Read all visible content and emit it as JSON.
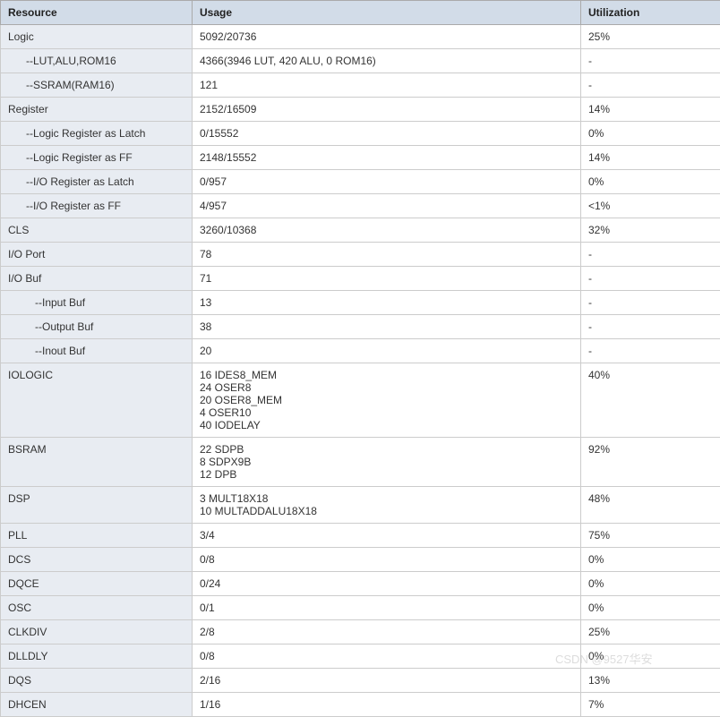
{
  "headers": {
    "resource": "Resource",
    "usage": "Usage",
    "utilization": "Utilization"
  },
  "rows": [
    {
      "resource": "Logic",
      "usage": "5092/20736",
      "utilization": "25%",
      "indent": 0
    },
    {
      "resource": "--LUT,ALU,ROM16",
      "usage": "4366(3946 LUT, 420 ALU, 0 ROM16)",
      "utilization": "-",
      "indent": 1
    },
    {
      "resource": "--SSRAM(RAM16)",
      "usage": "121",
      "utilization": "-",
      "indent": 1
    },
    {
      "resource": "Register",
      "usage": "2152/16509",
      "utilization": "14%",
      "indent": 0
    },
    {
      "resource": "--Logic Register as Latch",
      "usage": "0/15552",
      "utilization": "0%",
      "indent": 1
    },
    {
      "resource": "--Logic Register as FF",
      "usage": "2148/15552",
      "utilization": "14%",
      "indent": 1
    },
    {
      "resource": "--I/O Register as Latch",
      "usage": "0/957",
      "utilization": "0%",
      "indent": 1
    },
    {
      "resource": "--I/O Register as FF",
      "usage": "4/957",
      "utilization": "<1%",
      "indent": 1
    },
    {
      "resource": "CLS",
      "usage": "3260/10368",
      "utilization": "32%",
      "indent": 0
    },
    {
      "resource": "I/O Port",
      "usage": "78",
      "utilization": "-",
      "indent": 0
    },
    {
      "resource": "I/O Buf",
      "usage": "71",
      "utilization": "-",
      "indent": 0
    },
    {
      "resource": "--Input Buf",
      "usage": "13",
      "utilization": "-",
      "indent": 2
    },
    {
      "resource": "--Output Buf",
      "usage": "38",
      "utilization": "-",
      "indent": 2
    },
    {
      "resource": "--Inout Buf",
      "usage": "20",
      "utilization": "-",
      "indent": 2
    },
    {
      "resource": "IOLOGIC",
      "usage": "16 IDES8_MEM\n24 OSER8\n20 OSER8_MEM\n4 OSER10\n40 IODELAY",
      "utilization": "40%",
      "indent": 0
    },
    {
      "resource": "BSRAM",
      "usage": "22 SDPB\n8 SDPX9B\n12 DPB",
      "utilization": "92%",
      "indent": 0
    },
    {
      "resource": "DSP",
      "usage": "3 MULT18X18\n10 MULTADDALU18X18",
      "utilization": "48%",
      "indent": 0
    },
    {
      "resource": "PLL",
      "usage": "3/4",
      "utilization": "75%",
      "indent": 0
    },
    {
      "resource": "DCS",
      "usage": "0/8",
      "utilization": "0%",
      "indent": 0
    },
    {
      "resource": "DQCE",
      "usage": "0/24",
      "utilization": "0%",
      "indent": 0
    },
    {
      "resource": "OSC",
      "usage": "0/1",
      "utilization": "0%",
      "indent": 0
    },
    {
      "resource": "CLKDIV",
      "usage": "2/8",
      "utilization": "25%",
      "indent": 0
    },
    {
      "resource": "DLLDLY",
      "usage": "0/8",
      "utilization": "0%",
      "indent": 0
    },
    {
      "resource": "DQS",
      "usage": "2/16",
      "utilization": "13%",
      "indent": 0
    },
    {
      "resource": "DHCEN",
      "usage": "1/16",
      "utilization": "7%",
      "indent": 0
    }
  ],
  "watermark": "CSDN @9527华安"
}
